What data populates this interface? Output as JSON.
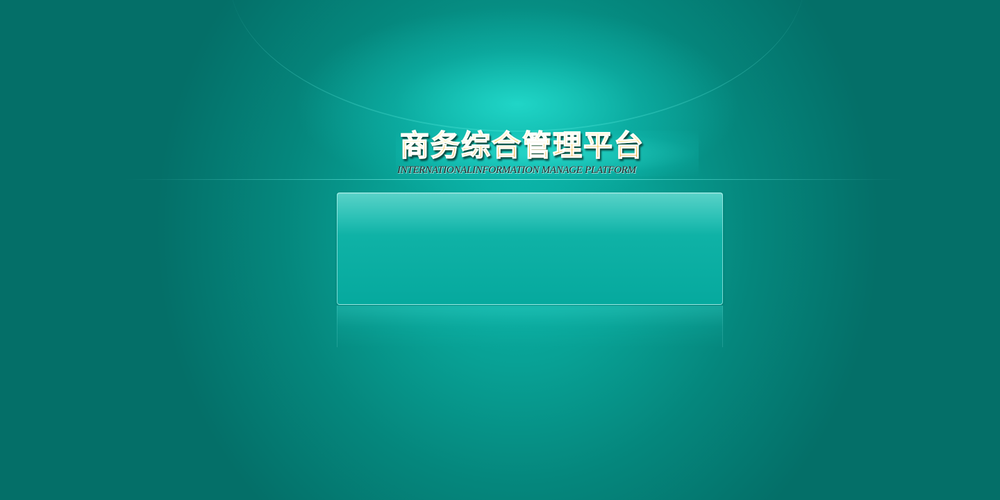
{
  "logo": {
    "title": "商务综合管理平台",
    "subtitle": "INTERNATIONALINFORMATION MANAGE PLATFORM"
  },
  "theme": {
    "background": "#046f68",
    "glow": "#0bb7ab",
    "panel": "#06a99e",
    "logo_gold": "#f4a000"
  },
  "login_panel": {}
}
